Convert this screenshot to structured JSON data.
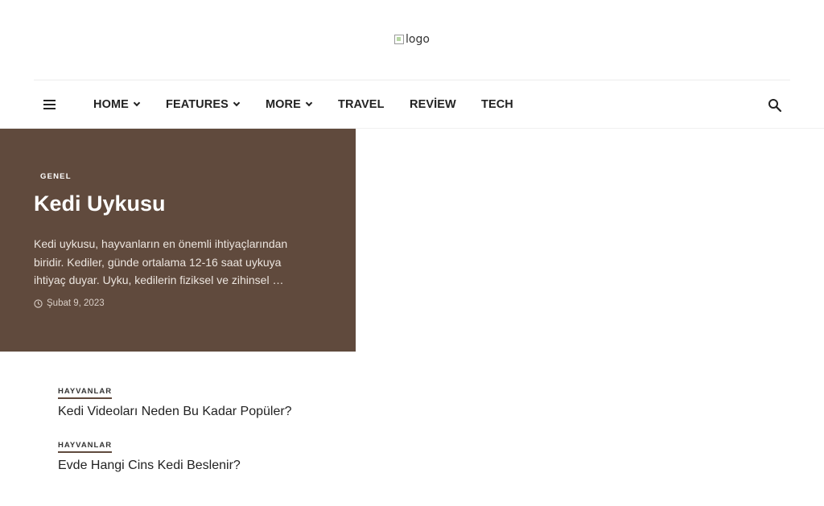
{
  "header": {
    "logo_alt": "logo"
  },
  "nav": {
    "items": [
      {
        "label": "HOME",
        "has_dropdown": true
      },
      {
        "label": "FEATURES",
        "has_dropdown": true
      },
      {
        "label": "MORE",
        "has_dropdown": true
      },
      {
        "label": "TRAVEL",
        "has_dropdown": false
      },
      {
        "label": "REVİEW",
        "has_dropdown": false
      },
      {
        "label": "TECH",
        "has_dropdown": false
      }
    ],
    "menu_icon": "hamburger-menu-icon",
    "search_icon": "search-icon"
  },
  "featured": {
    "category": "GENEL",
    "title": "Kedi Uykusu",
    "excerpt": "Kedi uykusu, hayvanların en önemli ihtiyaçlarından biridir. Kediler, günde ortalama 12-16 saat uykuya ihtiyaç duyar. Uyku, kedilerin fiziksel ve zihinsel …",
    "date": "Şubat 9, 2023",
    "date_icon": "clock-icon",
    "background_color": "#604a3d"
  },
  "posts": [
    {
      "category": "HAYVANLAR",
      "title": "Kedi Videoları Neden Bu Kadar Popüler?"
    },
    {
      "category": "HAYVANLAR",
      "title": "Evde Hangi Cins Kedi Beslenir?"
    }
  ],
  "colors": {
    "accent": "#604a3d",
    "text": "#222222"
  }
}
